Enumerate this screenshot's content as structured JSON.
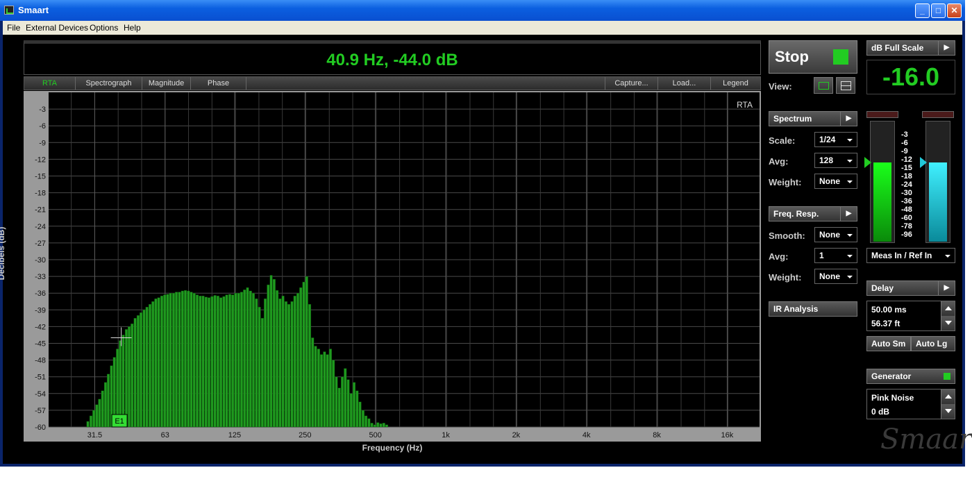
{
  "window": {
    "title": "Smaart",
    "minimize": "_",
    "maximize": "□",
    "close": "✕"
  },
  "menu": [
    "File",
    "External Devices",
    "Options",
    "Help"
  ],
  "readout": "40.9 Hz, -44.0 dB",
  "tabs": {
    "rta": "RTA",
    "spectrograph": "Spectrograph",
    "magnitude": "Magnitude",
    "phase": "Phase",
    "capture": "Capture...",
    "load": "Load...",
    "legend": "Legend"
  },
  "chart_data": {
    "type": "bar",
    "title": "RTA",
    "xlabel": "Frequency (Hz)",
    "ylabel": "Decibels (dB)",
    "xscale": "log",
    "xlim": [
      20,
      22000
    ],
    "ylim": [
      -60,
      0
    ],
    "xticks": [
      {
        "hz": 31.5,
        "label": "31.5"
      },
      {
        "hz": 63,
        "label": "63"
      },
      {
        "hz": 125,
        "label": "125"
      },
      {
        "hz": 250,
        "label": "250"
      },
      {
        "hz": 500,
        "label": "500"
      },
      {
        "hz": 1000,
        "label": "1k"
      },
      {
        "hz": 2000,
        "label": "2k"
      },
      {
        "hz": 4000,
        "label": "4k"
      },
      {
        "hz": 8000,
        "label": "8k"
      },
      {
        "hz": 16000,
        "label": "16k"
      }
    ],
    "yticks": [
      -3,
      -6,
      -9,
      -12,
      -15,
      -18,
      -21,
      -24,
      -27,
      -30,
      -33,
      -36,
      -39,
      -42,
      -45,
      -48,
      -51,
      -54,
      -57,
      -60
    ],
    "bar_color": "#1f9a1f",
    "grid": true,
    "resolution": "1/24 octave",
    "values": [
      {
        "hz": 29.5,
        "db": -59.0
      },
      {
        "hz": 30.4,
        "db": -58.0
      },
      {
        "hz": 31.3,
        "db": -57.0
      },
      {
        "hz": 32.2,
        "db": -56.0
      },
      {
        "hz": 33.1,
        "db": -55.0
      },
      {
        "hz": 34.1,
        "db": -53.5
      },
      {
        "hz": 35.1,
        "db": -52.0
      },
      {
        "hz": 36.1,
        "db": -50.5
      },
      {
        "hz": 37.2,
        "db": -49.0
      },
      {
        "hz": 38.3,
        "db": -47.5
      },
      {
        "hz": 39.5,
        "db": -46.0
      },
      {
        "hz": 40.6,
        "db": -44.5
      },
      {
        "hz": 41.8,
        "db": -43.5
      },
      {
        "hz": 43.1,
        "db": -42.5
      },
      {
        "hz": 44.3,
        "db": -42.0
      },
      {
        "hz": 45.6,
        "db": -41.5
      },
      {
        "hz": 47.0,
        "db": -40.5
      },
      {
        "hz": 48.4,
        "db": -40.0
      },
      {
        "hz": 49.8,
        "db": -39.5
      },
      {
        "hz": 51.3,
        "db": -39.0
      },
      {
        "hz": 52.8,
        "db": -38.5
      },
      {
        "hz": 54.4,
        "db": -38.0
      },
      {
        "hz": 56.0,
        "db": -37.5
      },
      {
        "hz": 57.6,
        "db": -37.0
      },
      {
        "hz": 59.3,
        "db": -36.8
      },
      {
        "hz": 61.1,
        "db": -36.5
      },
      {
        "hz": 62.9,
        "db": -36.3
      },
      {
        "hz": 64.7,
        "db": -36.2
      },
      {
        "hz": 66.6,
        "db": -36.0
      },
      {
        "hz": 68.6,
        "db": -36.0
      },
      {
        "hz": 70.6,
        "db": -35.8
      },
      {
        "hz": 72.7,
        "db": -35.8
      },
      {
        "hz": 74.9,
        "db": -35.6
      },
      {
        "hz": 77.1,
        "db": -35.5
      },
      {
        "hz": 79.4,
        "db": -35.6
      },
      {
        "hz": 81.7,
        "db": -35.8
      },
      {
        "hz": 84.1,
        "db": -36.0
      },
      {
        "hz": 86.6,
        "db": -36.3
      },
      {
        "hz": 89.2,
        "db": -36.5
      },
      {
        "hz": 91.8,
        "db": -36.5
      },
      {
        "hz": 94.5,
        "db": -36.7
      },
      {
        "hz": 97.3,
        "db": -36.8
      },
      {
        "hz": 100.2,
        "db": -36.6
      },
      {
        "hz": 103.2,
        "db": -36.4
      },
      {
        "hz": 106.2,
        "db": -36.5
      },
      {
        "hz": 109.4,
        "db": -36.8
      },
      {
        "hz": 112.6,
        "db": -36.6
      },
      {
        "hz": 115.9,
        "db": -36.3
      },
      {
        "hz": 119.4,
        "db": -36.2
      },
      {
        "hz": 122.9,
        "db": -36.3
      },
      {
        "hz": 126.5,
        "db": -36.0
      },
      {
        "hz": 130.3,
        "db": -36.0
      },
      {
        "hz": 134.1,
        "db": -35.8
      },
      {
        "hz": 138.1,
        "db": -35.4
      },
      {
        "hz": 142.2,
        "db": -35.0
      },
      {
        "hz": 146.4,
        "db": -35.6
      },
      {
        "hz": 150.7,
        "db": -36.0
      },
      {
        "hz": 155.2,
        "db": -37.0
      },
      {
        "hz": 159.8,
        "db": -38.5
      },
      {
        "hz": 164.5,
        "db": -40.5
      },
      {
        "hz": 169.4,
        "db": -37.0
      },
      {
        "hz": 174.4,
        "db": -34.5
      },
      {
        "hz": 179.5,
        "db": -32.8
      },
      {
        "hz": 184.8,
        "db": -33.5
      },
      {
        "hz": 190.3,
        "db": -35.5
      },
      {
        "hz": 195.9,
        "db": -37.0
      },
      {
        "hz": 201.7,
        "db": -36.5
      },
      {
        "hz": 207.7,
        "db": -37.5
      },
      {
        "hz": 213.8,
        "db": -38.0
      },
      {
        "hz": 220.2,
        "db": -37.5
      },
      {
        "hz": 226.7,
        "db": -36.5
      },
      {
        "hz": 233.4,
        "db": -36.0
      },
      {
        "hz": 240.3,
        "db": -35.0
      },
      {
        "hz": 247.4,
        "db": -34.0
      },
      {
        "hz": 254.7,
        "db": -33.0
      },
      {
        "hz": 262.3,
        "db": -38.0
      },
      {
        "hz": 270.0,
        "db": -44.0
      },
      {
        "hz": 278.0,
        "db": -45.5
      },
      {
        "hz": 286.3,
        "db": -46.0
      },
      {
        "hz": 294.8,
        "db": -47.0
      },
      {
        "hz": 303.5,
        "db": -46.5
      },
      {
        "hz": 312.5,
        "db": -47.0
      },
      {
        "hz": 321.7,
        "db": -46.0
      },
      {
        "hz": 331.3,
        "db": -48.0
      },
      {
        "hz": 341.1,
        "db": -51.0
      },
      {
        "hz": 351.2,
        "db": -53.0
      },
      {
        "hz": 361.6,
        "db": -51.0
      },
      {
        "hz": 372.3,
        "db": -49.5
      },
      {
        "hz": 383.4,
        "db": -51.5
      },
      {
        "hz": 394.7,
        "db": -54.0
      },
      {
        "hz": 406.4,
        "db": -52.0
      },
      {
        "hz": 418.4,
        "db": -53.5
      },
      {
        "hz": 430.8,
        "db": -55.5
      },
      {
        "hz": 443.6,
        "db": -57.0
      },
      {
        "hz": 456.7,
        "db": -58.0
      },
      {
        "hz": 470.3,
        "db": -58.5
      },
      {
        "hz": 484.2,
        "db": -59.3
      },
      {
        "hz": 498.6,
        "db": -59.6
      },
      {
        "hz": 513.3,
        "db": -59.2
      },
      {
        "hz": 528.5,
        "db": -59.4
      },
      {
        "hz": 544.2,
        "db": -59.3
      },
      {
        "hz": 560.3,
        "db": -59.6
      }
    ]
  },
  "cursor_marker": "E1",
  "right": {
    "stop_label": "Stop",
    "view_label": "View:",
    "spectrum_label": "Spectrum",
    "scale_label": "Scale:",
    "scale_value": "1/24",
    "avg_label": "Avg:",
    "avg_value": "128",
    "weight_label": "Weight:",
    "weight_value": "None",
    "freq_label": "Freq. Resp.",
    "smooth_label": "Smooth:",
    "smooth_value": "None",
    "avg2_label": "Avg:",
    "avg2_value": "1",
    "weight2_label": "Weight:",
    "weight2_value": "None",
    "ir_label": "IR Analysis",
    "dbfs_label": "dB Full Scale",
    "dbfs_value": "-16.0",
    "meter_scale": [
      "-3",
      "-6",
      "-9",
      "-12",
      "-15",
      "-18",
      "-24",
      "-30",
      "-36",
      "-48",
      "-60",
      "-78",
      "-96"
    ],
    "meter_left_level_db": -12,
    "meter_right_level_db": -12,
    "meas_select": "Meas In / Ref In",
    "delay_label": "Delay",
    "delay_ms": "50.00 ms",
    "delay_ft": "56.37 ft",
    "auto_sm": "Auto Sm",
    "auto_lg": "Auto Lg",
    "generator_label": "Generator",
    "gen_signal": "Pink Noise",
    "gen_level": "0 dB",
    "logo": "Smaart"
  },
  "colors": {
    "accent_green": "#22cc22",
    "meter_cyan": "#22c8d8"
  }
}
